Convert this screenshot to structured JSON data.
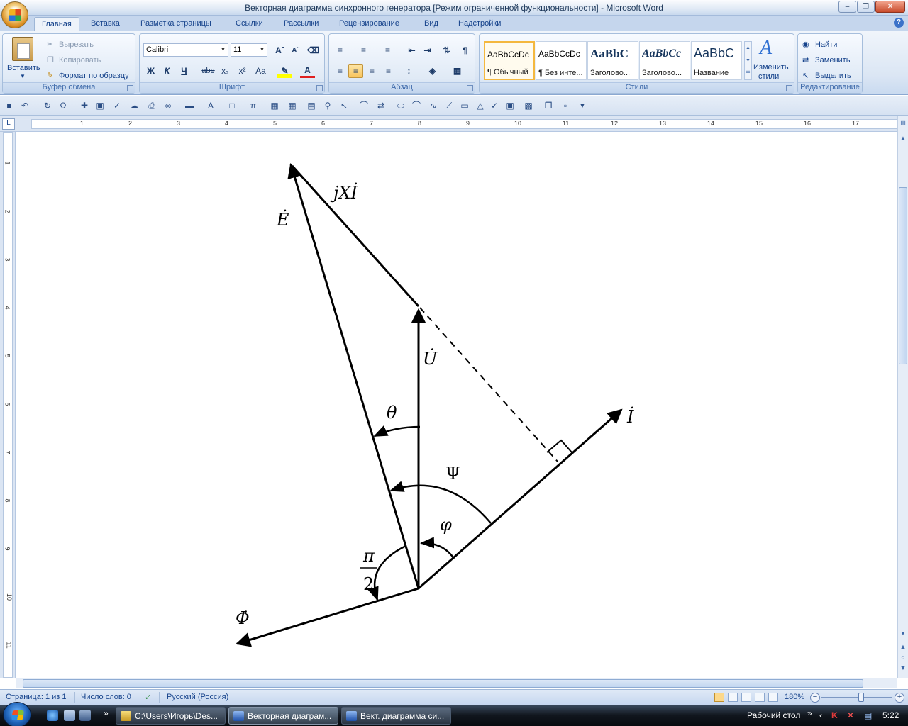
{
  "window": {
    "title": "Векторная диаграмма синхронного генератора [Режим ограниченной функциональности]  -  Microsoft Word"
  },
  "tabs": [
    "Главная",
    "Вставка",
    "Разметка страницы",
    "Ссылки",
    "Рассылки",
    "Рецензирование",
    "Вид",
    "Надстройки"
  ],
  "ribbon": {
    "clipboard": {
      "title": "Буфер обмена",
      "paste": "Вставить",
      "cut": "Вырезать",
      "copy": "Копировать",
      "format_painter": "Формат по образцу"
    },
    "font": {
      "title": "Шрифт",
      "font_name": "Calibri",
      "font_size": "11",
      "bold": "Ж",
      "italic": "К",
      "underline": "Ч",
      "strike": "abe",
      "sub": "x₂",
      "sup": "x²",
      "case": "Aa"
    },
    "paragraph": {
      "title": "Абзац"
    },
    "styles": {
      "title": "Стили",
      "items": [
        {
          "sample": "AaBbCcDc",
          "name": "¶ Обычный"
        },
        {
          "sample": "AaBbCcDc",
          "name": "¶ Без инте..."
        },
        {
          "sample": "AaBbC",
          "name": "Заголово..."
        },
        {
          "sample": "AaBbCc",
          "name": "Заголово..."
        },
        {
          "sample": "AaBbC",
          "name": "Название"
        }
      ],
      "change_styles_line1": "Изменить",
      "change_styles_line2": "стили"
    },
    "editing": {
      "title": "Редактирование",
      "find": "Найти",
      "replace": "Заменить",
      "select": "Выделить"
    }
  },
  "ruler": {
    "corner": "L",
    "h_numbers": [
      "1",
      "2",
      "3",
      "4",
      "5",
      "6",
      "7",
      "8",
      "9",
      "10",
      "11",
      "12",
      "13",
      "14",
      "15",
      "16",
      "17"
    ],
    "v_numbers": [
      "1",
      "2",
      "3",
      "4",
      "5",
      "6",
      "7",
      "8",
      "9",
      "10",
      "11"
    ]
  },
  "diagram": {
    "labels": {
      "E": "Ė",
      "jXI": "jXİ",
      "U": "U̇",
      "theta": "θ",
      "I": "İ",
      "Psi": "Ψ",
      "phi": "φ",
      "pi": "π",
      "two": "2",
      "Phi": "Φ̇"
    }
  },
  "status": {
    "page": "Страница: 1 из 1",
    "words": "Число слов: 0",
    "language": "Русский (Россия)",
    "zoom": "180%"
  },
  "taskbar": {
    "items": [
      "C:\\Users\\Игорь\\Des...",
      "Векторная диаграм...",
      "Вект. диаграмма си..."
    ],
    "desktop": "Рабочий стол",
    "clock": "5:22"
  }
}
